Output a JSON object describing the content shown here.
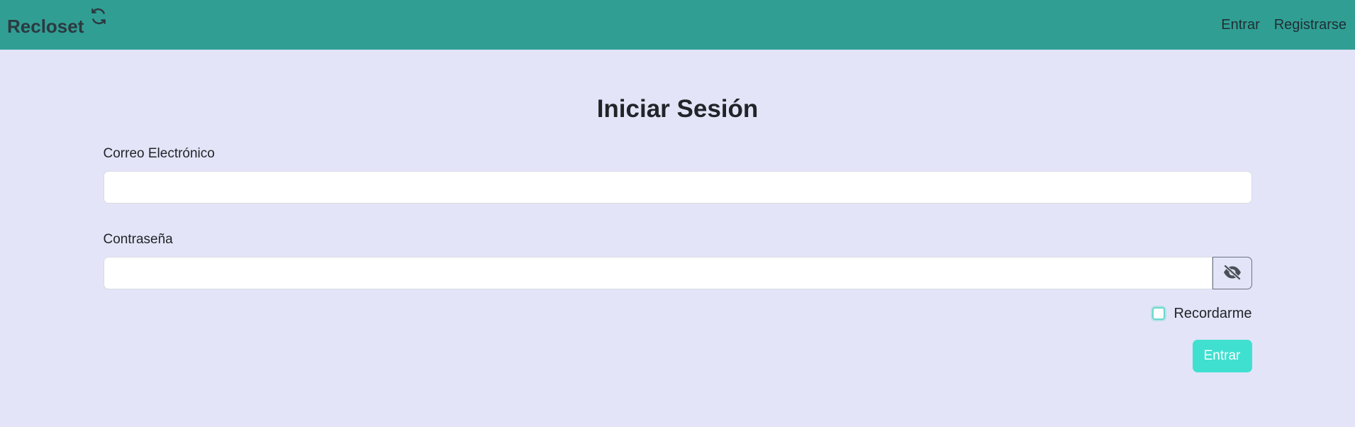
{
  "navbar": {
    "brand": "Recloset",
    "brand_icon": "sync-icon",
    "links": [
      "Entrar",
      "Registrarse"
    ]
  },
  "form": {
    "title": "Iniciar Sesión",
    "email_label": "Correo Electrónico",
    "email_value": "",
    "password_label": "Contraseña",
    "password_value": "",
    "toggle_icon": "eye-slash-icon",
    "remember_label": "Recordarme",
    "remember_checked": false,
    "submit_label": "Entrar"
  },
  "colors": {
    "navbar_bg": "#319e94",
    "page_bg": "#e4e4f8",
    "submit_bg": "#40e0d0"
  }
}
